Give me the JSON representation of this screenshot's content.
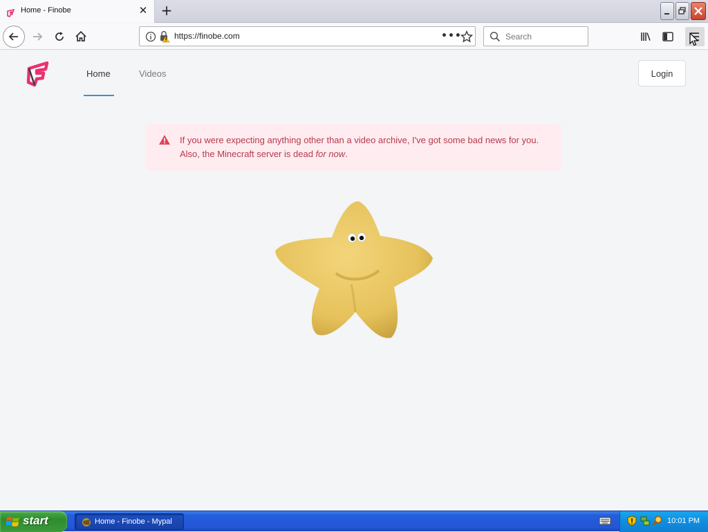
{
  "browser": {
    "tab": {
      "title": "Home - Finobe"
    },
    "url": "https://finobe.com",
    "search_placeholder": "Search"
  },
  "site": {
    "nav": {
      "home": "Home",
      "videos": "Videos"
    },
    "login_label": "Login",
    "alert": {
      "line1": "If you were expecting anything other than a video archive, I've got some bad news for you.",
      "line2_prefix": "Also, the Minecraft server is dead ",
      "line2_em": "for now",
      "line2_suffix": "."
    }
  },
  "taskbar": {
    "start_label": "start",
    "task_item": "Home - Finobe - Mypal",
    "clock": "10:01 PM"
  },
  "colors": {
    "accent": "#3e8ed0",
    "alert_bg": "#feecf0",
    "alert_text": "#b63a4b",
    "brand": "#e8336e"
  }
}
